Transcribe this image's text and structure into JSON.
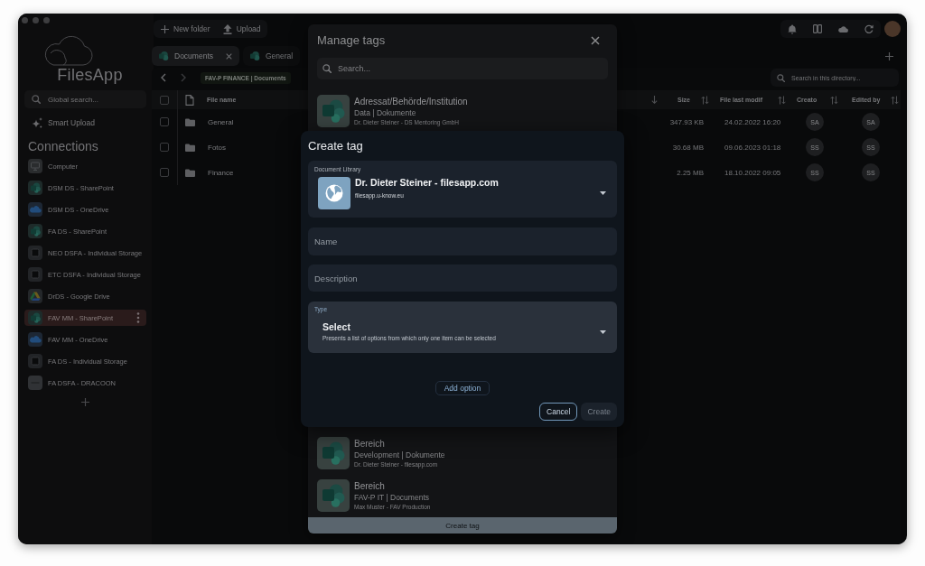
{
  "sidebar": {
    "app_name": "FilesApp",
    "search": {
      "placeholder": "Global search..."
    },
    "smart_upload": "Smart Upload",
    "connections_title": "Connections",
    "connections": [
      {
        "label": "Computer",
        "kind": "computer",
        "selected": false
      },
      {
        "label": "DSM DS - SharePoint",
        "kind": "sharepoint",
        "selected": false
      },
      {
        "label": "DSM DS - OneDrive",
        "kind": "onedrive",
        "selected": false
      },
      {
        "label": "FA DS - SharePoint",
        "kind": "sharepoint",
        "selected": false
      },
      {
        "label": "NEO DSFA - Individual Storage",
        "kind": "storage",
        "selected": false
      },
      {
        "label": "ETC DSFA - Individual Storage",
        "kind": "storage",
        "selected": false
      },
      {
        "label": "DrDS - Google Drive",
        "kind": "google-drive",
        "selected": false
      },
      {
        "label": "FAV MM - SharePoint",
        "kind": "sharepoint",
        "selected": true
      },
      {
        "label": "FAV MM - OneDrive",
        "kind": "onedrive",
        "selected": false
      },
      {
        "label": "FA DS - Individual Storage",
        "kind": "storage",
        "selected": false
      },
      {
        "label": "FA DSFA - DRACOON",
        "kind": "dracoon",
        "selected": false
      }
    ]
  },
  "toolbar": {
    "buttons": [
      {
        "label": "New folder",
        "kind": "new-folder"
      },
      {
        "label": "Upload",
        "kind": "upload"
      }
    ]
  },
  "tabs": [
    {
      "label": "Documents",
      "selected": true
    },
    {
      "label": "General",
      "selected": false
    }
  ],
  "breadcrumb": {
    "path": "FAV-P FINANCE | Documents"
  },
  "directory_search": {
    "placeholder": "Search in this directory..."
  },
  "table": {
    "all_checked": false,
    "columns": [
      "File name",
      "Size",
      "File last modif",
      "Creato",
      "Edited by"
    ],
    "rows": [
      {
        "checked": false,
        "name": "General",
        "size": "347.93 KB",
        "modified": "24.02.2022 16:20",
        "creator": "SA",
        "editor": "SA"
      },
      {
        "checked": false,
        "name": "Fotos",
        "size": "30.68 MB",
        "modified": "09.06.2023 01:18",
        "creator": "SS",
        "editor": "SS"
      },
      {
        "checked": false,
        "name": "Finance",
        "size": "2.25 MB",
        "modified": "18.10.2022 09:05",
        "creator": "SS",
        "editor": "SS"
      }
    ]
  },
  "manage_tags": {
    "title": "Manage tags",
    "search": {
      "placeholder": "Search..."
    },
    "tags": [
      {
        "name": "Adressat/Behörde/Institution",
        "library": "Data | Dokumente",
        "owner": "Dr. Dieter Steiner - DS Mentoring GmbH"
      },
      {
        "name": "Bereich",
        "library": "Development | Dokumente",
        "owner": "Dr. Dieter Steiner - filesapp.com"
      },
      {
        "name": "Bereich",
        "library": "FAV-P IT | Documents",
        "owner": "Max Muster - FAV Production"
      }
    ],
    "create_button": "Create tag"
  },
  "create_tag": {
    "title": "Create tag",
    "document_library": {
      "label": "Document Library",
      "name": "Dr. Dieter Steiner - filesapp.com",
      "address": "filesapp.u-know.eu"
    },
    "name_field": {
      "placeholder": "Name"
    },
    "description_field": {
      "placeholder": "Description"
    },
    "type": {
      "label": "Type",
      "value": "Select",
      "description": "Presents a list of options from which only one item can be selected"
    },
    "add_option": "Add option",
    "buttons": [
      {
        "label": "Cancel",
        "kind": "outlined",
        "disabled": false
      },
      {
        "label": "Create",
        "kind": "filled",
        "disabled": true
      }
    ]
  }
}
